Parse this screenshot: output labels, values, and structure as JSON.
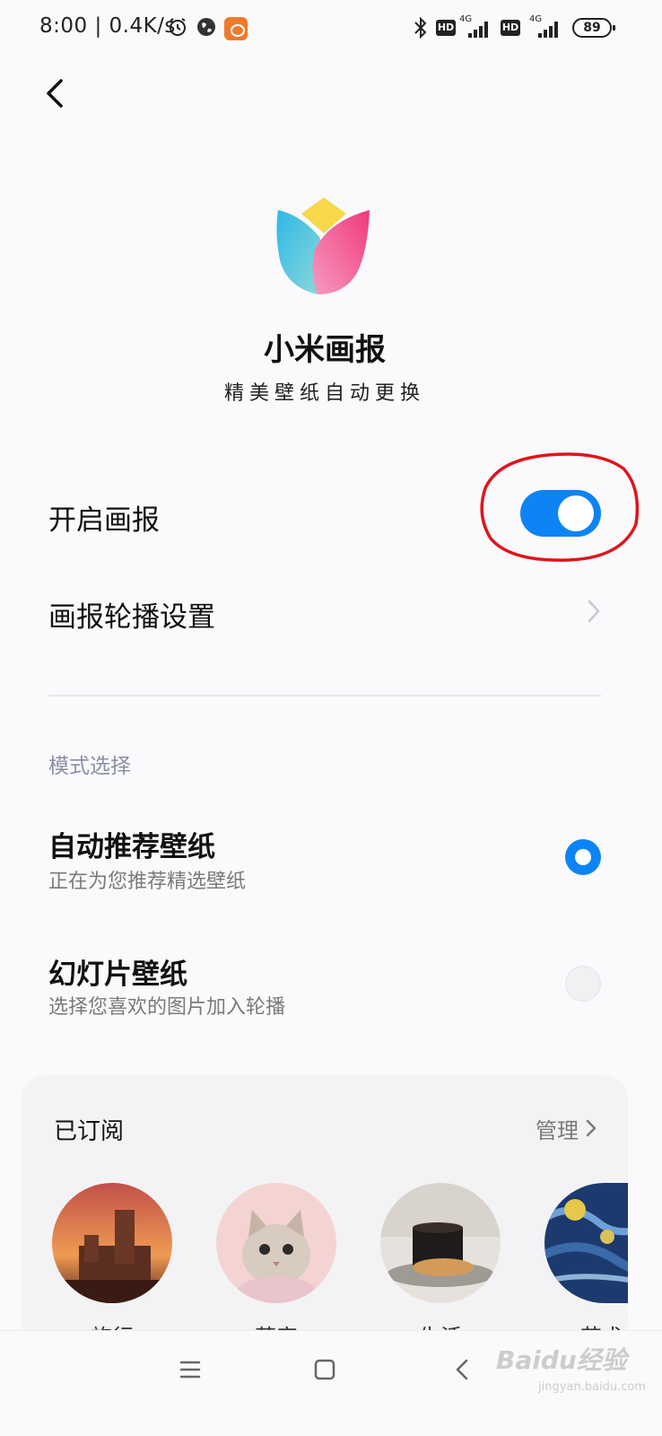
{
  "status_bar": {
    "time_speed": "8:00 | 0.4K/s",
    "hd_1": "HD",
    "hd_2": "HD",
    "net_1": "4G",
    "net_2": "4G",
    "battery": "89",
    "icons": [
      "alarm-icon",
      "globe-icon",
      "app-badge-icon",
      "bluetooth-icon",
      "signal-icon",
      "battery-icon"
    ]
  },
  "header": {
    "back_icon": "back-arrow-icon"
  },
  "app": {
    "title": "小米画报",
    "subtitle": "精美壁纸自动更换",
    "logo_colors": {
      "yellow": "#f6d84a",
      "cyan": "#3ec3e6",
      "pink": "#f35a8f"
    }
  },
  "settings": {
    "enable_label": "开启画报",
    "enable_on": true,
    "carousel_label": "画报轮播设置",
    "accent": "#0d84f6",
    "annotation_color": "#e0141c"
  },
  "mode": {
    "section_title": "模式选择",
    "options": [
      {
        "title": "自动推荐壁纸",
        "subtitle": "正在为您推荐精选壁纸",
        "selected": true
      },
      {
        "title": "幻灯片壁纸",
        "subtitle": "选择您喜欢的图片加入轮播",
        "selected": false
      }
    ]
  },
  "subscribed": {
    "title": "已订阅",
    "manage": "管理",
    "items": [
      {
        "label": "旅行"
      },
      {
        "label": "萌宠"
      },
      {
        "label": "生活"
      },
      {
        "label": "艺术"
      }
    ]
  },
  "nav": {
    "icons": [
      "menu-icon",
      "home-icon",
      "back-icon"
    ]
  },
  "watermark": {
    "brand": "Baidu经验",
    "url": "jingyan.baidu.com"
  }
}
